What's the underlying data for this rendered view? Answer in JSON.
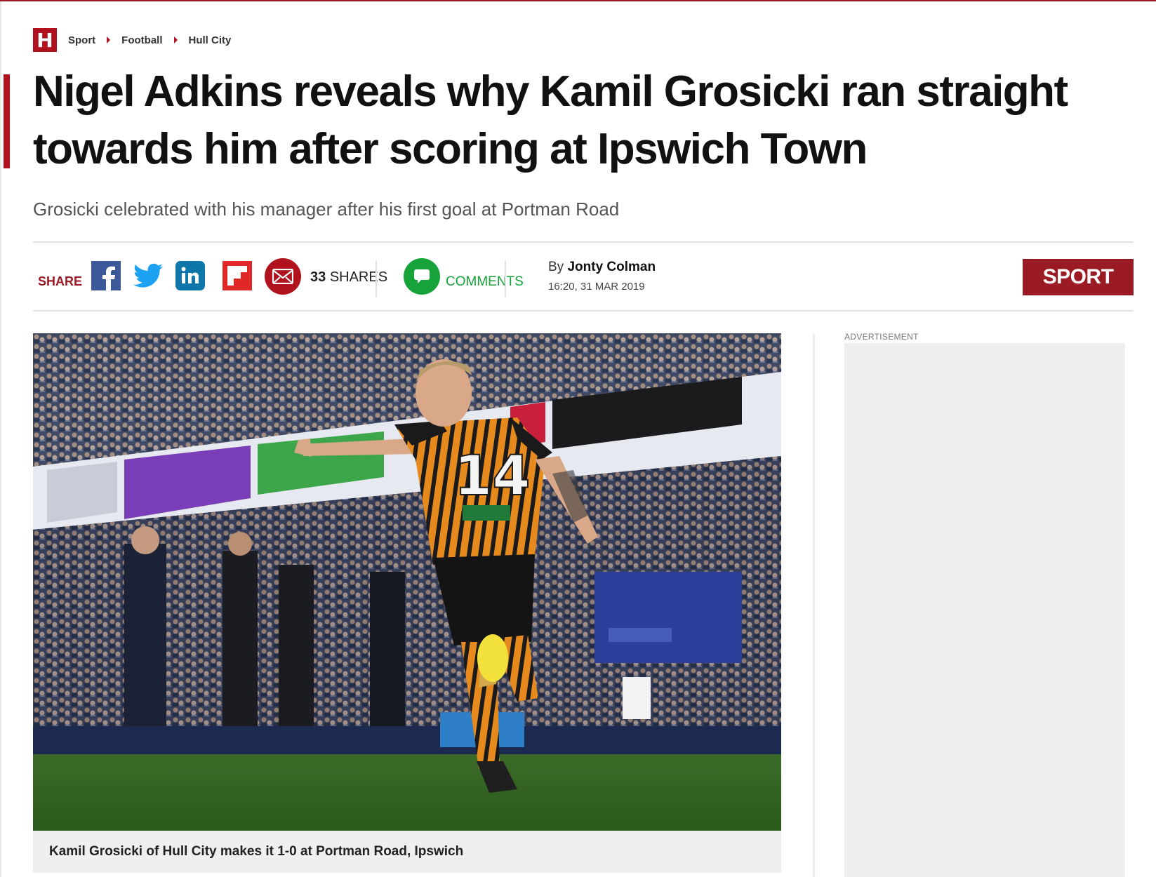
{
  "breadcrumb": {
    "logo": "H",
    "items": [
      "Sport",
      "Football",
      "Hull City"
    ]
  },
  "article": {
    "headline": "Nigel Adkins reveals why Kamil Grosicki ran straight towards him after scoring at Ipswich Town",
    "subheadline": "Grosicki celebrated with his manager after his first goal at Portman Road"
  },
  "share_bar": {
    "share_label": "SHARE",
    "icons": [
      "facebook-icon",
      "twitter-icon",
      "linkedin-icon",
      "flipboard-icon",
      "email-icon"
    ],
    "share_count": "33",
    "share_count_label": "SHARES",
    "comments_label": "COMMENTS",
    "byline_prefix": "By",
    "author": "Jonty Colman",
    "timestamp": "16:20, 31 MAR 2019",
    "section_badge": "SPORT"
  },
  "image": {
    "caption": "Kamil Grosicki of Hull City makes it 1-0 at Portman Road, Ipswich",
    "shirt_number": "14"
  },
  "sidebar": {
    "ad_label": "ADVERTISEMENT"
  },
  "colors": {
    "brand_red": "#b0131d",
    "dark_red": "#9b1b24",
    "comments_green": "#18a33a",
    "facebook_blue": "#3b5998",
    "linkedin_blue": "#0e76a8",
    "flipboard_red": "#e12828"
  }
}
